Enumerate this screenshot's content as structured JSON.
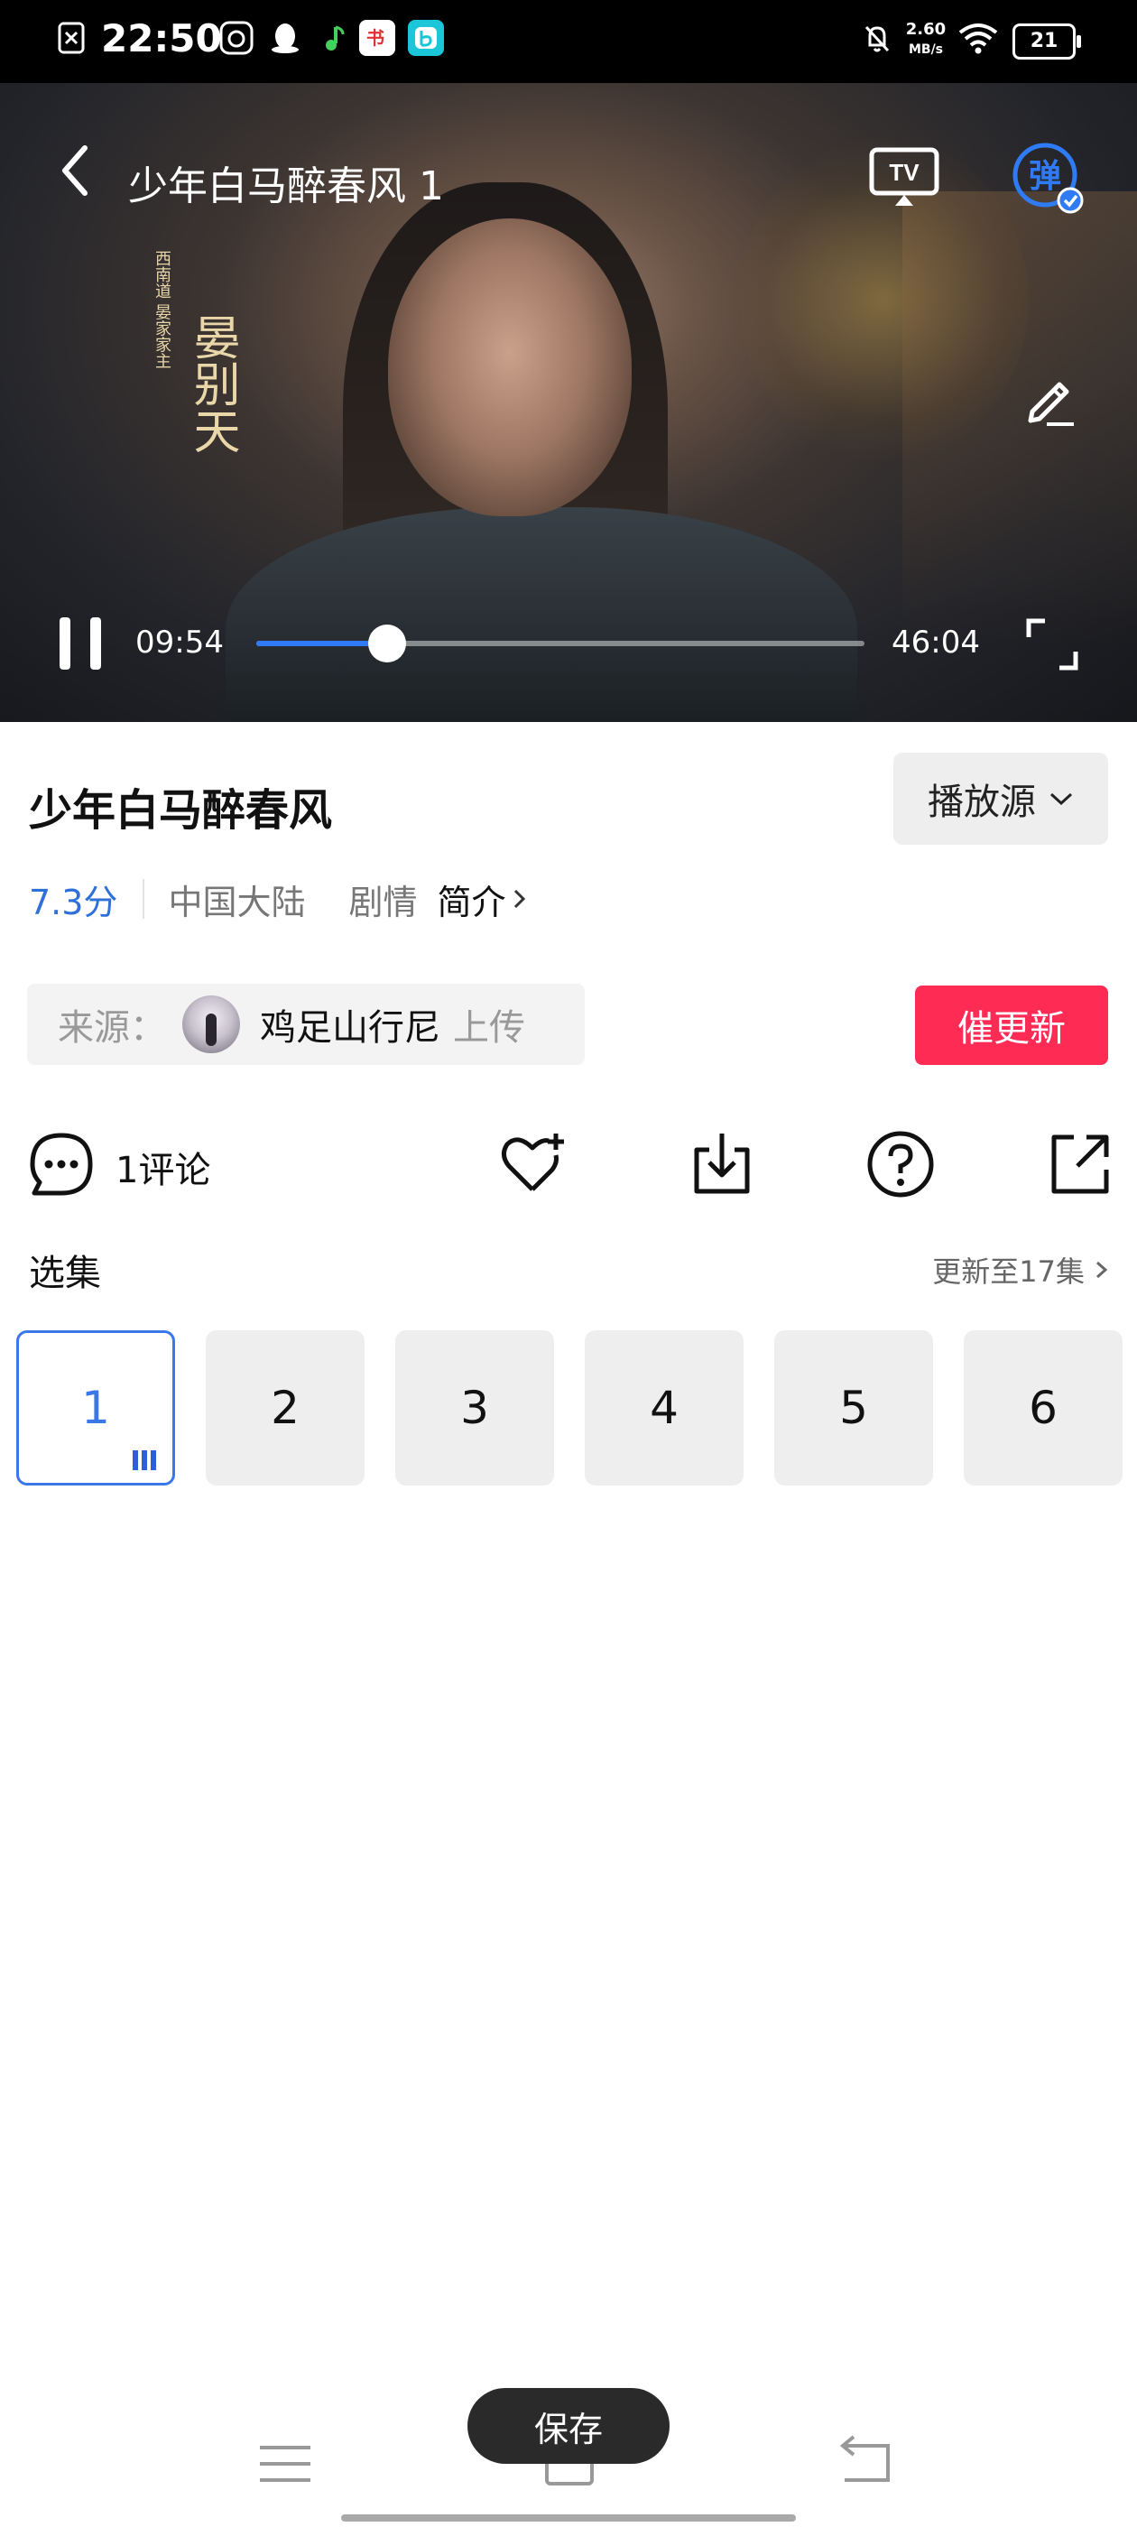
{
  "status_bar": {
    "time": "22:50",
    "network_speed_value": "2.60",
    "network_speed_unit": "MB/s",
    "battery": "21",
    "app_icon_word": "书"
  },
  "video": {
    "title": "少年白马醉春风 1",
    "current_time": "09:54",
    "total_time": "46:04",
    "progress": 0.215,
    "tv_label": "TV",
    "danmu_label": "弹",
    "caption_small": "西南道 晏家家主",
    "caption_name": "晏别天",
    "accent_color": "#2f7bf5"
  },
  "info": {
    "title": "少年白马醉春风",
    "source_button": "播放源",
    "rating": "7.3分",
    "region": "中国大陆",
    "genre": "剧情",
    "intro_link": "简介",
    "upload_label": "来源：",
    "uploader": "鸡足山行尼",
    "upload_suffix": "上传",
    "urge_button": "催更新",
    "urge_color": "#fe2c55"
  },
  "actions": {
    "comment_label": "1评论",
    "icons": [
      "comment-icon",
      "favorite-add-icon",
      "download-icon",
      "help-icon",
      "share-icon"
    ]
  },
  "episodes": {
    "header": "选集",
    "more_label": "更新至17集",
    "items": [
      "1",
      "2",
      "3",
      "4",
      "5",
      "6"
    ],
    "active_index": 0,
    "active_color": "#3a78e8"
  },
  "bottom": {
    "save_label": "保存"
  }
}
